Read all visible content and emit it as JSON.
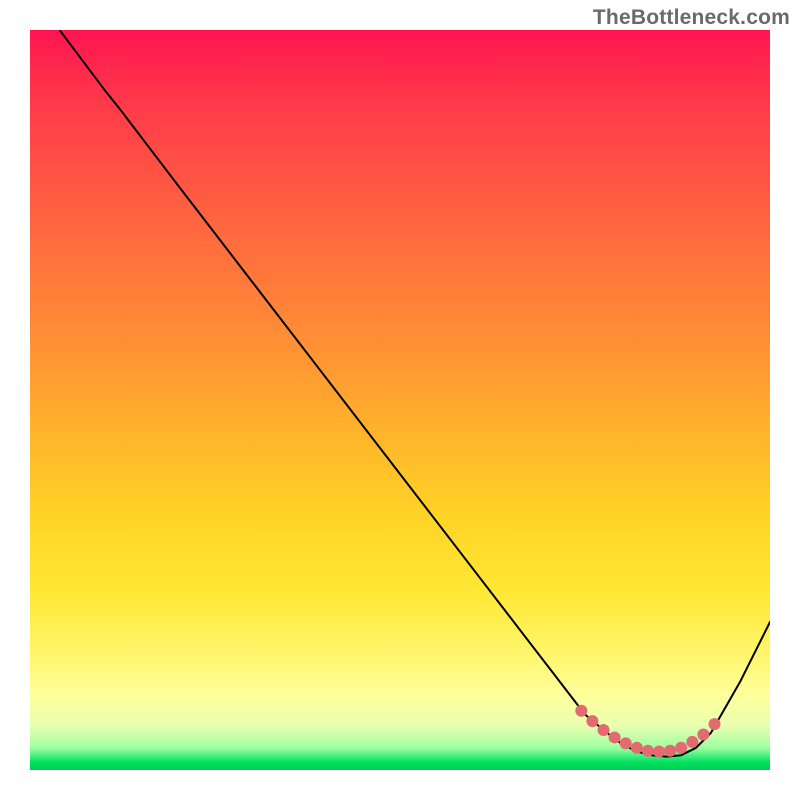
{
  "watermark": "TheBottleneck.com",
  "chart_data": {
    "type": "line",
    "title": "",
    "xlabel": "",
    "ylabel": "",
    "xlim": [
      0,
      100
    ],
    "ylim": [
      0,
      100
    ],
    "grid": false,
    "series": [
      {
        "name": "curve",
        "x": [
          4,
          10,
          12,
          20,
          30,
          40,
          50,
          60,
          70,
          75,
          78,
          80,
          82,
          84,
          86,
          88,
          90,
          92,
          96,
          100
        ],
        "y": [
          100,
          92,
          89.5,
          79,
          66,
          53,
          40,
          27,
          14,
          7.5,
          5,
          3.5,
          2.5,
          2,
          1.8,
          2,
          3,
          5,
          12,
          20
        ],
        "color": "#000000"
      }
    ],
    "highlight_points": {
      "name": "minima-cluster",
      "color": "#e46a72",
      "x": [
        74.5,
        76,
        77.5,
        79,
        80.5,
        82,
        83.5,
        85,
        86.5,
        88,
        89.5,
        91,
        92.5
      ],
      "y": [
        8.0,
        6.6,
        5.4,
        4.4,
        3.6,
        3.0,
        2.6,
        2.5,
        2.6,
        3.0,
        3.8,
        4.8,
        6.2
      ]
    },
    "background_gradient": {
      "top_color": "#ff1450",
      "mid_colors": [
        "#ff7a3a",
        "#ffd426",
        "#ffff9c"
      ],
      "bottom_color": "#00cc50"
    }
  }
}
